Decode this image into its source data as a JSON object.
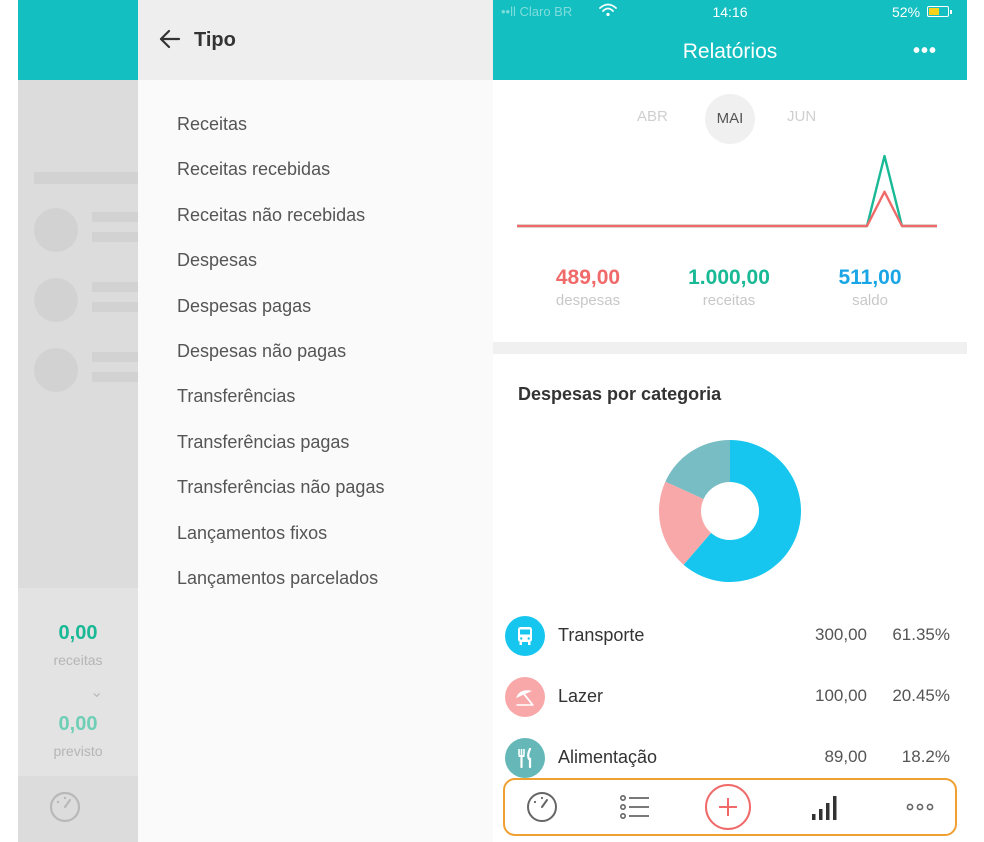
{
  "background_screen": {
    "receitas_value": "0,00",
    "receitas_label": "receitas",
    "previsto_value": "0,00",
    "previsto_label": "previsto",
    "chevron": "⌄"
  },
  "filter_panel": {
    "title": "Tipo",
    "items": [
      "Receitas",
      "Receitas recebidas",
      "Receitas não recebidas",
      "Despesas",
      "Despesas pagas",
      "Despesas não pagas",
      "Transferências",
      "Transferências pagas",
      "Transferências não pagas",
      "Lançamentos fixos",
      "Lançamentos parcelados"
    ]
  },
  "status_bar": {
    "carrier": "••ll Claro BR",
    "time": "14:16",
    "battery": "52%"
  },
  "report": {
    "title": "Relatórios",
    "more": "•••",
    "months": {
      "prev": "ABR",
      "current": "MAI",
      "next": "JUN"
    },
    "summary": {
      "despesas_value": "489,00",
      "despesas_label": "despesas",
      "receitas_value": "1.000,00",
      "receitas_label": "receitas",
      "saldo_value": "511,00",
      "saldo_label": "saldo"
    },
    "categories_title": "Despesas por categoria",
    "categories": [
      {
        "name": "Transporte",
        "amount": "300,00",
        "percent": "61.35%",
        "color": "#17c6ef",
        "icon": "bus-icon"
      },
      {
        "name": "Lazer",
        "amount": "100,00",
        "percent": "20.45%",
        "color": "#f8a8a8",
        "icon": "umbrella-icon"
      },
      {
        "name": "Alimentação",
        "amount": "89,00",
        "percent": "18.2%",
        "color": "#66b8b8",
        "icon": "fork-knife-icon"
      }
    ]
  },
  "colors": {
    "teal": "#13bfc0",
    "expense_red": "#f06a6a",
    "income_green": "#19b996",
    "balance_blue": "#1aa6e6",
    "nav_highlight": "#f0a030"
  },
  "chart_data": {
    "type": "pie",
    "title": "Despesas por categoria",
    "categories": [
      "Transporte",
      "Lazer",
      "Alimentação"
    ],
    "values": [
      300,
      100,
      89
    ],
    "percents": [
      61.35,
      20.45,
      18.2
    ],
    "colors": [
      "#17c6ef",
      "#f8a8a8",
      "#78bcc4"
    ],
    "donut": true
  },
  "line_chart": {
    "type": "line",
    "series": [
      {
        "values": [
          0,
          0,
          0,
          0,
          0,
          0,
          0,
          0,
          0,
          0,
          0,
          0,
          0,
          0,
          0,
          0,
          0,
          0,
          0,
          0,
          0,
          1000,
          0,
          0,
          0
        ]
      },
      {
        "values": [
          0,
          0,
          0,
          0,
          0,
          0,
          0,
          0,
          0,
          0,
          0,
          0,
          0,
          0,
          0,
          0,
          0,
          0,
          0,
          0,
          0,
          489,
          0,
          0,
          0
        ]
      }
    ],
    "colors": [
      "#19b996",
      "#f06a6a"
    ]
  },
  "bottom_nav": {
    "items": [
      "dashboard-gauge-icon",
      "transactions-list-icon",
      "add-plus-icon",
      "reports-bars-icon",
      "more-dots-icon"
    ]
  }
}
